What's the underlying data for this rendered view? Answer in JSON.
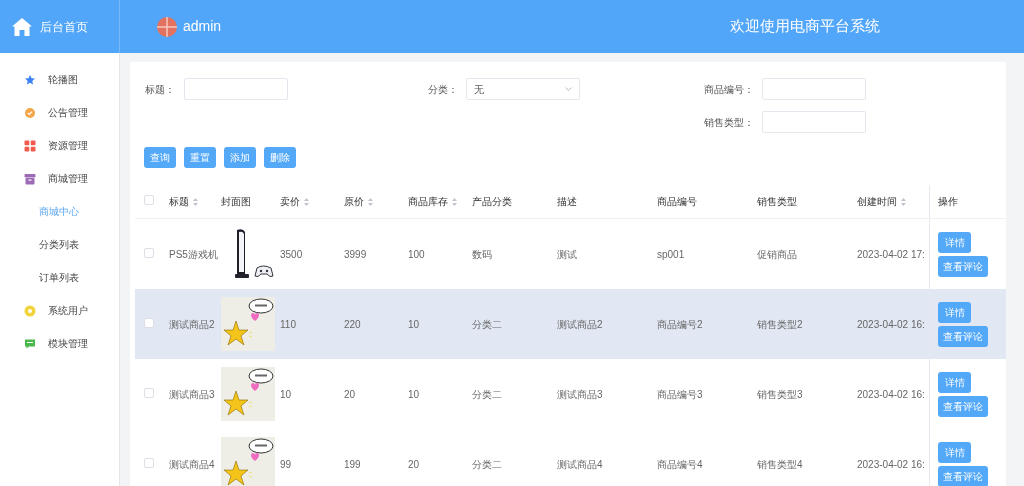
{
  "header": {
    "home_label": "后台首页",
    "user": "admin",
    "title": "欢迎使用电商平台系统"
  },
  "sidebar": {
    "items": [
      {
        "label": "轮播图",
        "kind": "star"
      },
      {
        "label": "公告管理",
        "kind": "badge"
      },
      {
        "label": "资源管理",
        "kind": "grid"
      },
      {
        "label": "商城管理",
        "kind": "box",
        "children": [
          {
            "label": "商城中心",
            "selected": true
          },
          {
            "label": "分类列表",
            "selected": false
          },
          {
            "label": "订单列表",
            "selected": false
          }
        ]
      },
      {
        "label": "系统用户",
        "kind": "dot"
      },
      {
        "label": "模块管理",
        "kind": "chat"
      }
    ]
  },
  "filters": {
    "title": {
      "label": "标题："
    },
    "category": {
      "label": "分类：",
      "value": "无"
    },
    "code": {
      "label": "商品编号："
    },
    "sale_type": {
      "label": "销售类型："
    }
  },
  "actions": [
    "查询",
    "重置",
    "添加",
    "删除"
  ],
  "table": {
    "select_all": {
      "checked": false
    },
    "columns": [
      {
        "label": "标题",
        "sortable": true
      },
      {
        "label": "封面图",
        "sortable": false
      },
      {
        "label": "卖价",
        "sortable": true
      },
      {
        "label": "原价",
        "sortable": true
      },
      {
        "label": "商品库存",
        "sortable": true
      },
      {
        "label": "产品分类",
        "sortable": false
      },
      {
        "label": "描述",
        "sortable": false
      },
      {
        "label": "商品编号",
        "sortable": false
      },
      {
        "label": "销售类型",
        "sortable": false
      },
      {
        "label": "创建时间",
        "sortable": true
      },
      {
        "label": "操作",
        "sortable": false
      }
    ],
    "rows": [
      {
        "checked": false,
        "highlighted": false,
        "title": "PS5游戏机",
        "price": "3500",
        "original_price": "3999",
        "stock": "100",
        "category": "数码",
        "description": "测试",
        "code": "sp001",
        "sale_type": "促销商品",
        "created": "2023-04-02 17:",
        "buttons": [
          "详情",
          "查看评论"
        ]
      },
      {
        "checked": false,
        "highlighted": true,
        "title": "测试商品2",
        "price": "110",
        "original_price": "220",
        "stock": "10",
        "category": "分类二",
        "description": "测试商品2",
        "code": "商品编号2",
        "sale_type": "销售类型2",
        "created": "2023-04-02 16:",
        "buttons": [
          "详情",
          "查看评论"
        ]
      },
      {
        "checked": false,
        "highlighted": false,
        "title": "测试商品3",
        "price": "10",
        "original_price": "20",
        "stock": "10",
        "category": "分类二",
        "description": "测试商品3",
        "code": "商品编号3",
        "sale_type": "销售类型3",
        "created": "2023-04-02 16:",
        "buttons": [
          "详情",
          "查看评论"
        ]
      },
      {
        "checked": false,
        "highlighted": false,
        "title": "测试商品4",
        "price": "99",
        "original_price": "199",
        "stock": "20",
        "category": "分类二",
        "description": "测试商品4",
        "code": "商品编号4",
        "sale_type": "销售类型4",
        "created": "2023-04-02 16:",
        "buttons": [
          "详情",
          "查看评论"
        ]
      }
    ]
  }
}
